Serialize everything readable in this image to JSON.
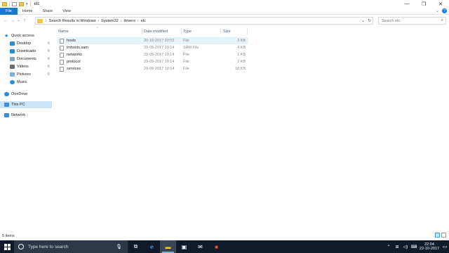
{
  "window": {
    "title": "etc",
    "controls": {
      "minimize": "—",
      "maximize": "❐",
      "close": "✕"
    }
  },
  "ribbon": {
    "tabs": [
      "File",
      "Home",
      "Share",
      "View"
    ],
    "expand": "⌄",
    "help": "?"
  },
  "address": {
    "back": "←",
    "forward": "→",
    "recent": "⌄",
    "up": "↑",
    "crumbs": [
      "Search Results in Windows",
      "System32",
      "drivers",
      "etc"
    ],
    "separator": "›",
    "dropdown": "⌄",
    "refresh": "↻"
  },
  "search": {
    "placeholder": "Search etc",
    "icon": "⌕"
  },
  "nav": {
    "quick_access": "Quick access",
    "items": [
      {
        "label": "Desktop",
        "icon": "desktop-icon",
        "color": "#2b8bd8",
        "pinned": true
      },
      {
        "label": "Downloads",
        "icon": "downloads-icon",
        "color": "#2b8bd8",
        "pinned": true
      },
      {
        "label": "Documents",
        "icon": "documents-icon",
        "color": "#8aa0b8",
        "pinned": true
      },
      {
        "label": "Videos",
        "icon": "videos-icon",
        "color": "#6b6b6b",
        "pinned": true
      },
      {
        "label": "Pictures",
        "icon": "pictures-icon",
        "color": "#7fb1d8",
        "pinned": true
      },
      {
        "label": "Music",
        "icon": "music-icon",
        "color": "#2b8bd8",
        "pinned": false
      }
    ],
    "onedrive": "OneDrive",
    "thispc": "This PC",
    "network": "Network",
    "pin_glyph": "⚲"
  },
  "columns": {
    "name": "Name",
    "date": "Date modified",
    "type": "Type",
    "size": "Size"
  },
  "files": [
    {
      "name": "hosts",
      "date": "20-10-2017 20:52",
      "type": "File",
      "size": "3 KB"
    },
    {
      "name": "lmhosts.sam",
      "date": "29-09-2017 19:14",
      "type": "SAM File",
      "size": "4 KB"
    },
    {
      "name": "networks",
      "date": "29-09-2017 19:14",
      "type": "File",
      "size": "1 KB"
    },
    {
      "name": "protocol",
      "date": "29-09-2017 19:14",
      "type": "File",
      "size": "2 KB"
    },
    {
      "name": "services",
      "date": "29-09-2017 19:14",
      "type": "File",
      "size": "18 KB"
    }
  ],
  "status": {
    "items": "5 items"
  },
  "taskbar": {
    "search_placeholder": "Type here to search",
    "mic": "🎙",
    "apps": [
      {
        "icon": "task-view-icon",
        "glyph": "⧉",
        "active": false
      },
      {
        "icon": "edge-icon",
        "glyph": "e",
        "active": false
      },
      {
        "icon": "file-explorer-icon",
        "glyph": "▬",
        "active": true
      },
      {
        "icon": "store-icon",
        "glyph": "▣",
        "active": false
      },
      {
        "icon": "mail-icon",
        "glyph": "✉",
        "active": false
      },
      {
        "icon": "office-icon",
        "glyph": "■",
        "active": false
      }
    ],
    "tray": {
      "up": "⌃",
      "network": "⊞",
      "volume": "◁)",
      "keyboard": "⌨"
    },
    "time": "22:04",
    "date": "22-10-2017",
    "notifications": "▭"
  }
}
